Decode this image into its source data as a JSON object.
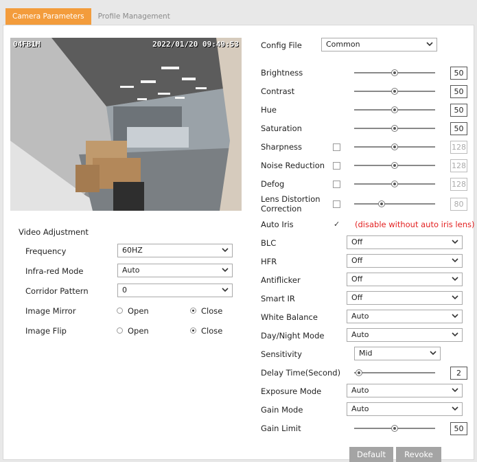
{
  "tabs": [
    {
      "label": "Camera Parameters",
      "active": true
    },
    {
      "label": "Profile Management",
      "active": false
    }
  ],
  "video": {
    "camera_name": "04FB1M",
    "timestamp": "2022/01/20 09:49:53"
  },
  "video_adjustment": {
    "title": "Video Adjustment",
    "frequency": {
      "label": "Frequency",
      "value": "60HZ"
    },
    "infrared_mode": {
      "label": "Infra-red Mode",
      "value": "Auto"
    },
    "corridor_pattern": {
      "label": "Corridor Pattern",
      "value": "0"
    },
    "image_mirror": {
      "label": "Image Mirror",
      "open": "Open",
      "close": "Close",
      "selected": "Close"
    },
    "image_flip": {
      "label": "Image Flip",
      "open": "Open",
      "close": "Close",
      "selected": "Close"
    }
  },
  "config_file": {
    "label": "Config File",
    "value": "Common"
  },
  "sliders": [
    {
      "label": "Brightness",
      "value": "50",
      "level": 0.5,
      "checkbox": null,
      "disabled": false
    },
    {
      "label": "Contrast",
      "value": "50",
      "level": 0.5,
      "checkbox": null,
      "disabled": false
    },
    {
      "label": "Hue",
      "value": "50",
      "level": 0.5,
      "checkbox": null,
      "disabled": false
    },
    {
      "label": "Saturation",
      "value": "50",
      "level": 0.5,
      "checkbox": null,
      "disabled": false
    },
    {
      "label": "Sharpness",
      "value": "128",
      "level": 0.5,
      "checkbox": false,
      "disabled": true
    },
    {
      "label": "Noise Reduction",
      "value": "128",
      "level": 0.5,
      "checkbox": false,
      "disabled": true
    },
    {
      "label": "Defog",
      "value": "128",
      "level": 0.5,
      "checkbox": false,
      "disabled": true
    },
    {
      "label": "Lens Distortion",
      "label2": "Correction",
      "value": "80",
      "level": 0.32,
      "checkbox": false,
      "disabled": true
    }
  ],
  "auto_iris": {
    "label": "Auto Iris",
    "checked": true,
    "note": "(disable without auto iris lens)"
  },
  "selects": [
    {
      "label": "BLC",
      "value": "Off"
    },
    {
      "label": "HFR",
      "value": "Off"
    },
    {
      "label": "Antiflicker",
      "value": "Off"
    },
    {
      "label": "Smart IR",
      "value": "Off"
    },
    {
      "label": "White Balance",
      "value": "Auto"
    },
    {
      "label": "Day/Night Mode",
      "value": "Auto"
    }
  ],
  "sensitivity": {
    "label": "Sensitivity",
    "value": "Mid"
  },
  "delay_time": {
    "label": "Delay Time(Second)",
    "value": "2",
    "level": 0.02
  },
  "exposure_mode": {
    "label": "Exposure Mode",
    "value": "Auto"
  },
  "gain_mode": {
    "label": "Gain Mode",
    "value": "Auto"
  },
  "gain_limit": {
    "label": "Gain Limit",
    "value": "50",
    "level": 0.5
  },
  "buttons": {
    "default": "Default",
    "revoke": "Revoke"
  },
  "colors": {
    "accent": "#f39c3c",
    "warning": "#e32020",
    "button": "#a4a4a4"
  }
}
